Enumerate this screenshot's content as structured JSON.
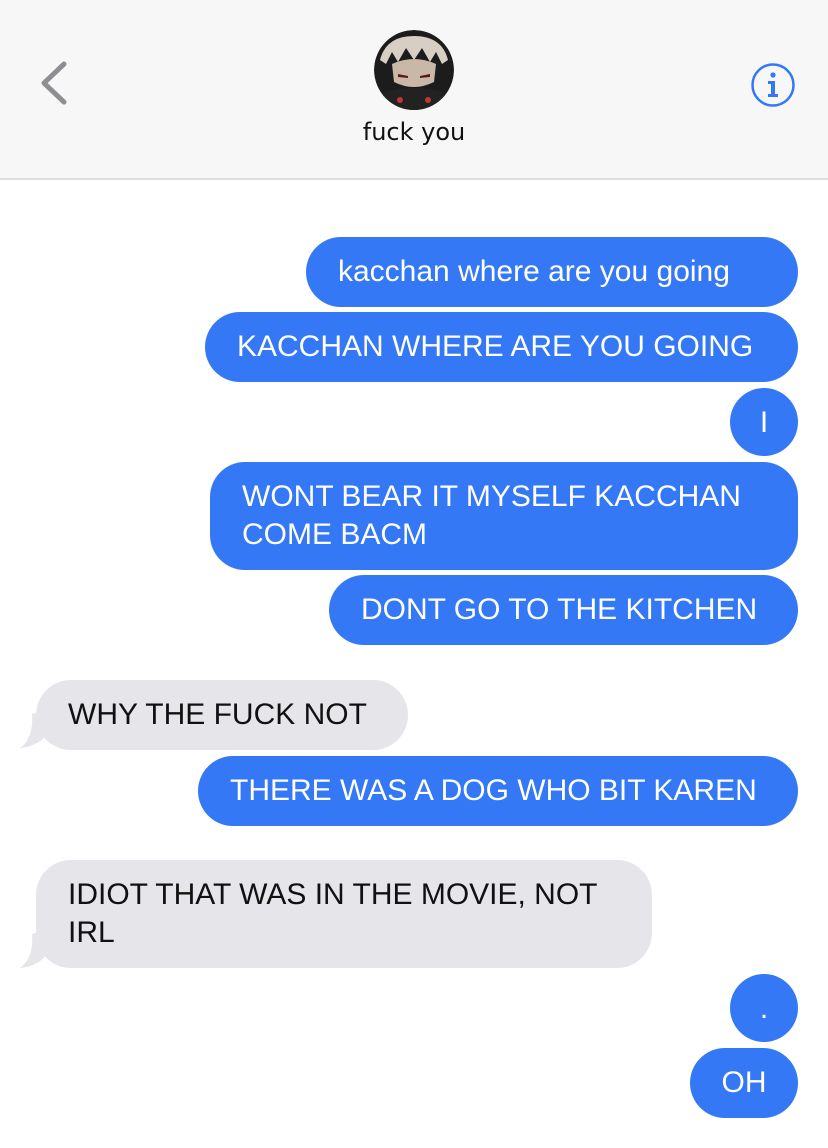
{
  "header": {
    "contact_name": "fuck you",
    "back_icon": "chevron-left-icon",
    "info_icon": "info-icon",
    "accent_color": "#3478f6"
  },
  "messages": [
    {
      "direction": "outgoing",
      "text": "kacchan where are you going"
    },
    {
      "direction": "outgoing",
      "text": "KACCHAN WHERE ARE YOU GOING"
    },
    {
      "direction": "outgoing",
      "text": "I"
    },
    {
      "direction": "outgoing",
      "text": "WONT BEAR IT MYSELF KACCHAN COME BACM"
    },
    {
      "direction": "outgoing",
      "text": "DONT GO TO THE KITCHEN"
    },
    {
      "direction": "incoming",
      "text": "WHY THE FUCK NOT"
    },
    {
      "direction": "outgoing",
      "text": "THERE WAS A DOG WHO BIT KAREN"
    },
    {
      "direction": "incoming",
      "text": "IDIOT THAT WAS IN THE MOVIE, NOT IRL"
    },
    {
      "direction": "outgoing",
      "text": "."
    },
    {
      "direction": "outgoing",
      "text": "OH"
    }
  ],
  "colors": {
    "outgoing_bubble": "#3478f6",
    "incoming_bubble": "#e5e5ea",
    "header_bg": "#f7f7f7"
  }
}
